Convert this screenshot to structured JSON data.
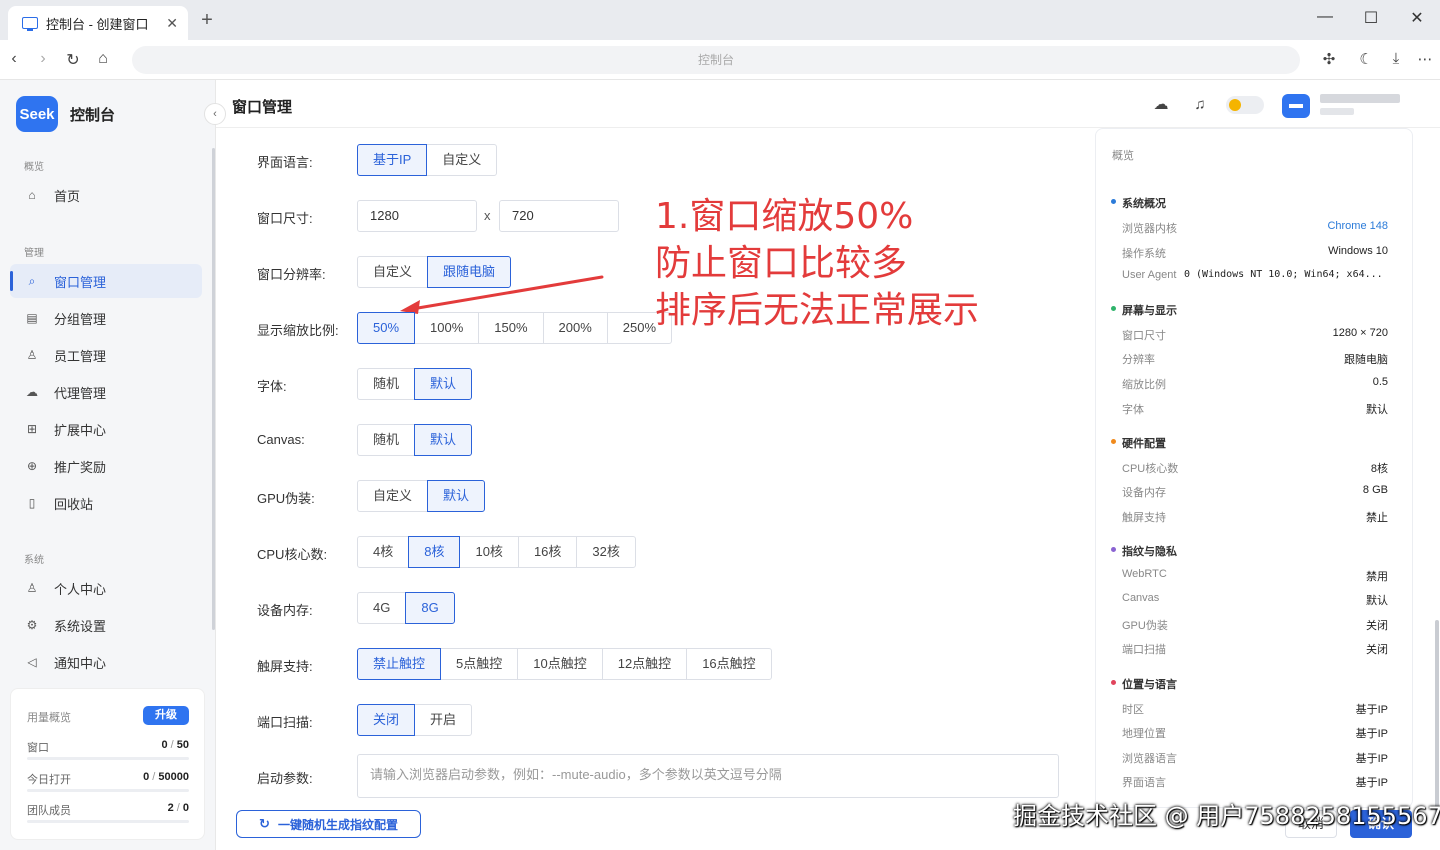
{
  "browser": {
    "tab_title": "控制台 - 创建窗口",
    "tab_close": "✕",
    "new_tab": "+",
    "address": "控制台",
    "win_min": "—",
    "win_max": "☐",
    "win_close": "✕"
  },
  "app": {
    "logo": "Seek",
    "title": "控制台",
    "page_title": "窗口管理"
  },
  "sidebar": {
    "sections": [
      {
        "label": "概览",
        "items": [
          {
            "label": "首页",
            "icon": "home-icon"
          }
        ]
      },
      {
        "label": "管理",
        "items": [
          {
            "label": "窗口管理",
            "icon": "search-icon",
            "active": true
          },
          {
            "label": "分组管理",
            "icon": "group-icon"
          },
          {
            "label": "员工管理",
            "icon": "users-icon"
          },
          {
            "label": "代理管理",
            "icon": "cloud-icon"
          },
          {
            "label": "扩展中心",
            "icon": "grid-icon"
          },
          {
            "label": "推广奖励",
            "icon": "gift-icon"
          },
          {
            "label": "回收站",
            "icon": "trash-icon"
          }
        ]
      },
      {
        "label": "系统",
        "items": [
          {
            "label": "个人中心",
            "icon": "user-icon"
          },
          {
            "label": "系统设置",
            "icon": "gear-icon"
          },
          {
            "label": "通知中心",
            "icon": "megaphone-icon"
          }
        ]
      }
    ],
    "usage": {
      "title": "用量概览",
      "upgrade": "升级",
      "rows": [
        {
          "label": "窗口",
          "used": "0",
          "total": "50"
        },
        {
          "label": "今日打开",
          "used": "0",
          "total": "50000"
        },
        {
          "label": "团队成员",
          "used": "2",
          "total": "0"
        }
      ]
    }
  },
  "form": {
    "language": {
      "label": "界面语言:",
      "options": [
        "基于IP",
        "自定义"
      ],
      "selected": 0
    },
    "window_size": {
      "label": "窗口尺寸:",
      "width": "1280",
      "x": "x",
      "height": "720"
    },
    "resolution": {
      "label": "窗口分辨率:",
      "options": [
        "自定义",
        "跟随电脑"
      ],
      "selected": 1
    },
    "zoom": {
      "label": "显示缩放比例:",
      "options": [
        "50%",
        "100%",
        "150%",
        "200%",
        "250%"
      ],
      "selected": 0
    },
    "font": {
      "label": "字体:",
      "options": [
        "随机",
        "默认"
      ],
      "selected": 1
    },
    "canvas": {
      "label": "Canvas:",
      "options": [
        "随机",
        "默认"
      ],
      "selected": 1
    },
    "gpu": {
      "label": "GPU伪装:",
      "options": [
        "自定义",
        "默认"
      ],
      "selected": 1
    },
    "cpu": {
      "label": "CPU核心数:",
      "options": [
        "4核",
        "8核",
        "10核",
        "16核",
        "32核"
      ],
      "selected": 1
    },
    "memory": {
      "label": "设备内存:",
      "options": [
        "4G",
        "8G"
      ],
      "selected": 1
    },
    "touch": {
      "label": "触屏支持:",
      "options": [
        "禁止触控",
        "5点触控",
        "10点触控",
        "12点触控",
        "16点触控"
      ],
      "selected": 0
    },
    "port_scan": {
      "label": "端口扫描:",
      "options": [
        "关闭",
        "开启"
      ],
      "selected": 0
    },
    "launch_args": {
      "label": "启动参数:",
      "placeholder": "请输入浏览器启动参数，例如：--mute-audio，多个参数以英文逗号分隔"
    },
    "generate": "一键随机生成指纹配置"
  },
  "annotation": {
    "lines": [
      "1.窗口缩放50%",
      "防止窗口比较多",
      "排序后无法正常展示"
    ],
    "color": "#e33b3b"
  },
  "overview": {
    "title": "概览",
    "sections": [
      {
        "title": "系统概况",
        "color": "#2b7bd9",
        "rows": [
          {
            "k": "浏览器内核",
            "v": "Chrome 148",
            "style": "blue"
          },
          {
            "k": "操作系统",
            "v": "Windows 10"
          },
          {
            "k": "User Agent",
            "v": "0 (Windows NT 10.0; Win64; x64...",
            "style": "mono"
          }
        ]
      },
      {
        "title": "屏幕与显示",
        "color": "#2fb36b",
        "rows": [
          {
            "k": "窗口尺寸",
            "v": "1280 × 720"
          },
          {
            "k": "分辨率",
            "v": "跟随电脑"
          },
          {
            "k": "缩放比例",
            "v": "0.5"
          },
          {
            "k": "字体",
            "v": "默认"
          }
        ]
      },
      {
        "title": "硬件配置",
        "color": "#f08a1c",
        "rows": [
          {
            "k": "CPU核心数",
            "v": "8核"
          },
          {
            "k": "设备内存",
            "v": "8 GB"
          },
          {
            "k": "触屏支持",
            "v": "禁止"
          }
        ]
      },
      {
        "title": "指纹与隐私",
        "color": "#8a63d2",
        "rows": [
          {
            "k": "WebRTC",
            "v": "禁用"
          },
          {
            "k": "Canvas",
            "v": "默认"
          },
          {
            "k": "GPU伪装",
            "v": "关闭"
          },
          {
            "k": "端口扫描",
            "v": "关闭"
          }
        ]
      },
      {
        "title": "位置与语言",
        "color": "#e0445c",
        "rows": [
          {
            "k": "时区",
            "v": "基于IP"
          },
          {
            "k": "地理位置",
            "v": "基于IP"
          },
          {
            "k": "浏览器语言",
            "v": "基于IP"
          },
          {
            "k": "界面语言",
            "v": "基于IP"
          }
        ]
      }
    ]
  },
  "footer": {
    "cancel": "取消",
    "confirm": "确认"
  },
  "watermark": "掘金技术社区 @ 用户7588258155567"
}
